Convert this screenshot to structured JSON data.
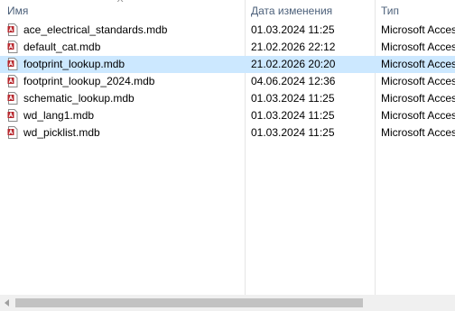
{
  "columns": {
    "name": "Имя",
    "date": "Дата изменения",
    "type": "Тип"
  },
  "sort_indicator": "^",
  "files": [
    {
      "name": "ace_electrical_standards.mdb",
      "date": "01.03.2024 11:25",
      "type": "Microsoft Acces",
      "icon": "access-db-icon",
      "selected": false
    },
    {
      "name": "default_cat.mdb",
      "date": "21.02.2026 22:12",
      "type": "Microsoft Acces",
      "icon": "access-db-icon",
      "selected": false
    },
    {
      "name": "footprint_lookup.mdb",
      "date": "21.02.2026 20:20",
      "type": "Microsoft Acces",
      "icon": "access-db-icon",
      "selected": true
    },
    {
      "name": "footprint_lookup_2024.mdb",
      "date": "04.06.2024 12:36",
      "type": "Microsoft Acces",
      "icon": "access-db-icon",
      "selected": false
    },
    {
      "name": "schematic_lookup.mdb",
      "date": "01.03.2024 11:25",
      "type": "Microsoft Acces",
      "icon": "access-db-icon",
      "selected": false
    },
    {
      "name": "wd_lang1.mdb",
      "date": "01.03.2024 11:25",
      "type": "Microsoft Acces",
      "icon": "access-db-icon",
      "selected": false
    },
    {
      "name": "wd_picklist.mdb",
      "date": "01.03.2024 11:25",
      "type": "Microsoft Acces",
      "icon": "access-db-icon",
      "selected": false
    }
  ],
  "colors": {
    "selection": "#cce8ff",
    "header_text": "#4c607a",
    "icon_red": "#b7282e"
  }
}
